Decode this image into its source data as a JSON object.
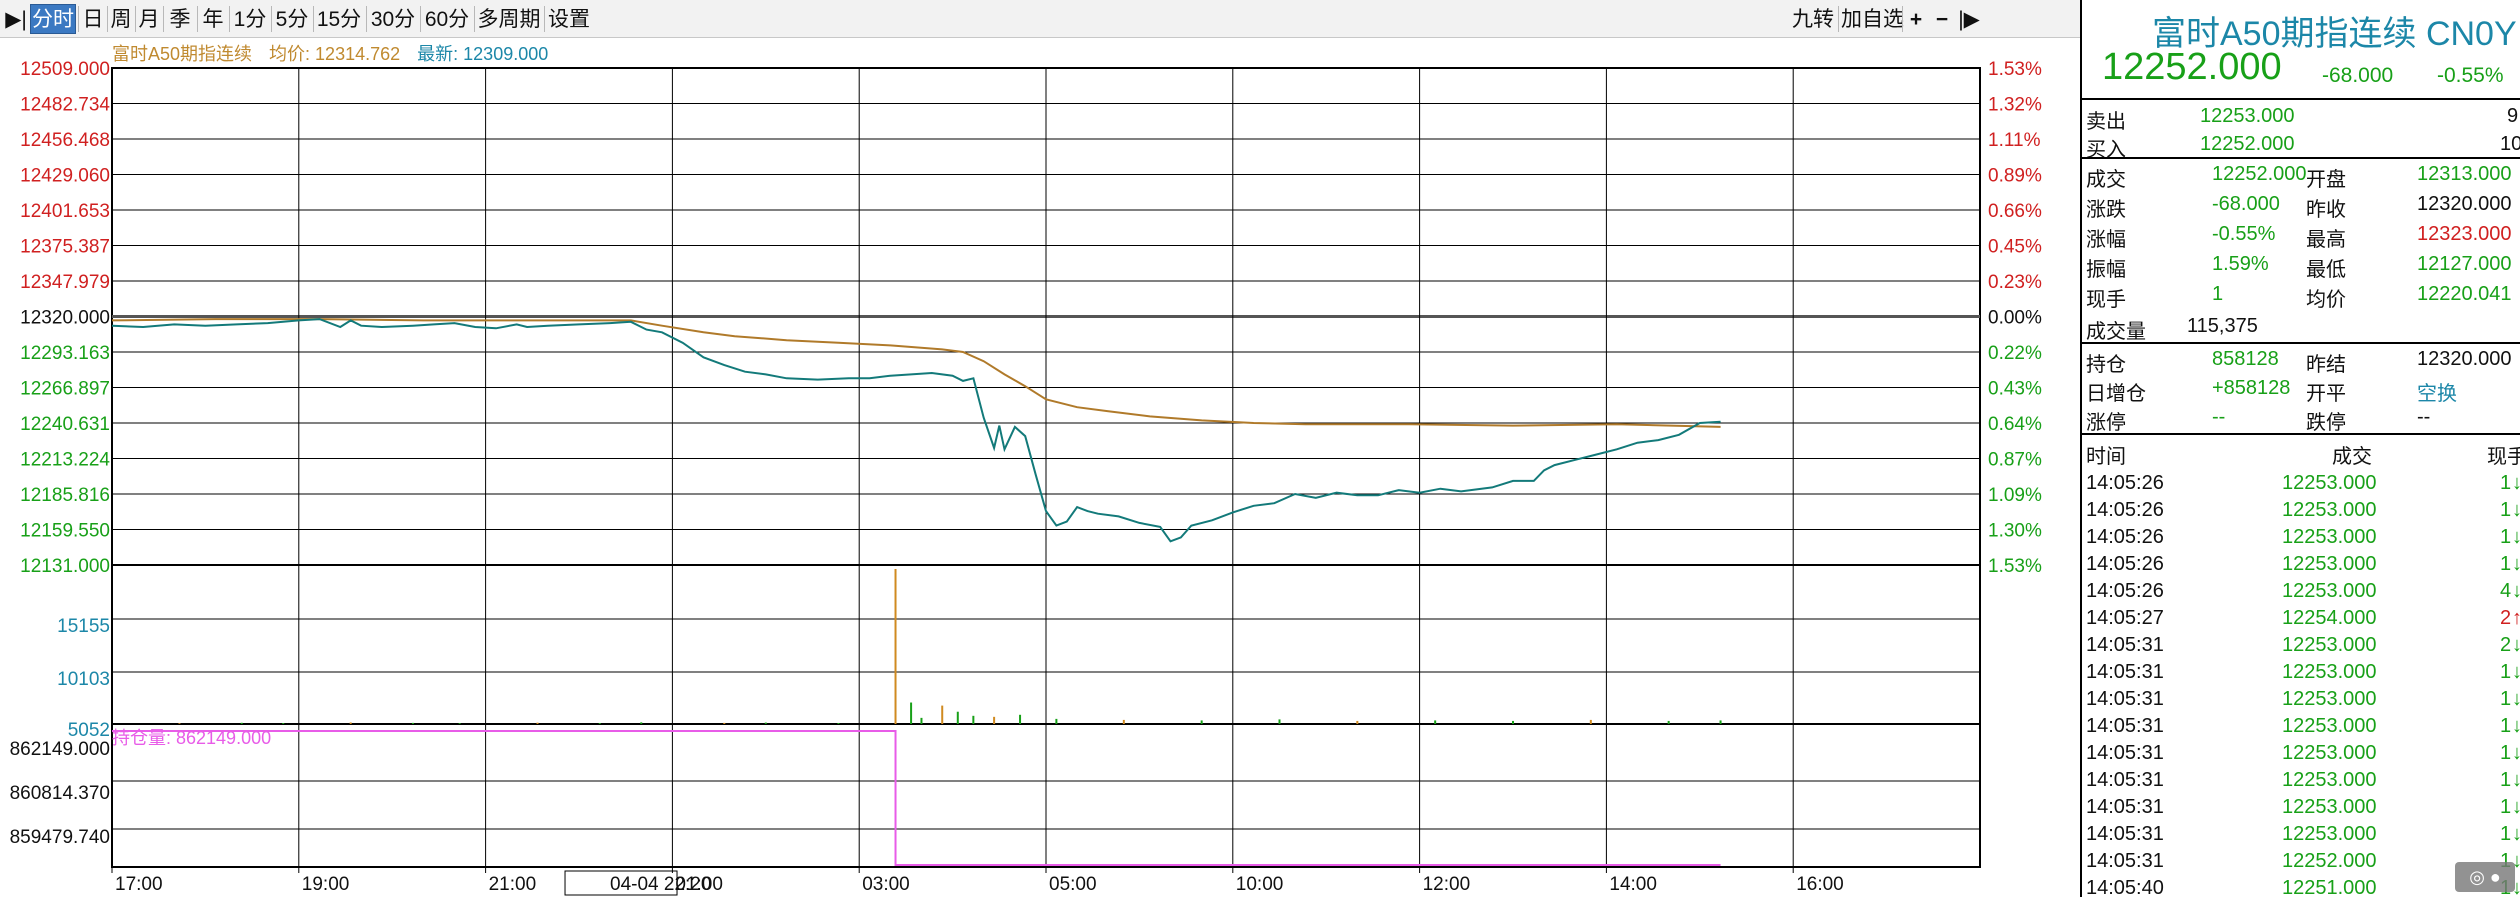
{
  "toolbar": {
    "left": [
      "▶|",
      "分时",
      "日",
      "周",
      "月",
      "季",
      "年",
      "1分",
      "5分",
      "15分",
      "30分",
      "60分",
      "多周期",
      "设置"
    ],
    "right": [
      "九转",
      "加自选",
      "+",
      "−",
      "|▶"
    ]
  },
  "info": {
    "name": "富时A50期指连续",
    "avg": "均价: 12314.762",
    "latest": "最新: 12309.000"
  },
  "price_axis": [
    "12509.000",
    "12482.734",
    "12456.468",
    "12429.060",
    "12401.653",
    "12375.387",
    "12347.979",
    "12320.000",
    "12293.163",
    "12266.897",
    "12240.631",
    "12213.224",
    "12185.816",
    "12159.550",
    "12131.000"
  ],
  "pct_axis": [
    "1.53%",
    "1.32%",
    "1.11%",
    "0.89%",
    "0.66%",
    "0.45%",
    "0.23%",
    "0.00%",
    "0.22%",
    "0.43%",
    "0.64%",
    "0.87%",
    "1.09%",
    "1.30%",
    "1.53%"
  ],
  "vol_axis": [
    "15155",
    "10103",
    "5052"
  ],
  "oi": {
    "label": "持仓量: 862149.000",
    "axis": [
      "862149.000",
      "860814.370",
      "859479.740"
    ]
  },
  "time_axis": [
    "17:00",
    "19:00",
    "21:00",
    "04-04 22:20",
    "01:00",
    "03:00",
    "05:00",
    "10:00",
    "12:00",
    "14:00",
    "16:00"
  ],
  "panel": {
    "title": "富时A50期指连续 CN0Y",
    "price": "12252.000",
    "change": "-68.000",
    "change_pct": "-0.55%",
    "ask_label": "卖出",
    "ask_price": "12253.000",
    "ask_vol": "9",
    "bid_label": "买入",
    "bid_price": "12252.000",
    "bid_vol": "10",
    "stats": [
      {
        "l1": "成交",
        "v1": "12252.000",
        "l2": "开盘",
        "v2": "12313.000"
      },
      {
        "l1": "涨跌",
        "v1": "-68.000",
        "l2": "昨收",
        "v2": "12320.000"
      },
      {
        "l1": "涨幅",
        "v1": "-0.55%",
        "l2": "最高",
        "v2": "12323.000"
      },
      {
        "l1": "振幅",
        "v1": "1.59%",
        "l2": "最低",
        "v2": "12127.000"
      },
      {
        "l1": "现手",
        "v1": "1",
        "l2": "均价",
        "v2": "12220.041"
      }
    ],
    "volume_label": "成交量",
    "volume": "115,375",
    "stats2": [
      {
        "l1": "持仓",
        "v1": "858128",
        "l2": "昨结",
        "v2": "12320.000"
      },
      {
        "l1": "日增仓",
        "v1": "+858128",
        "l2": "开平",
        "v2": "空换"
      },
      {
        "l1": "涨停",
        "v1": "--",
        "l2": "跌停",
        "v2": "--"
      }
    ],
    "tick_headers": [
      "时间",
      "成交",
      "现手"
    ],
    "ticks": [
      {
        "t": "14:05:26",
        "p": "12253.000",
        "v": "1",
        "d": "down"
      },
      {
        "t": "14:05:26",
        "p": "12253.000",
        "v": "1",
        "d": "down"
      },
      {
        "t": "14:05:26",
        "p": "12253.000",
        "v": "1",
        "d": "down"
      },
      {
        "t": "14:05:26",
        "p": "12253.000",
        "v": "1",
        "d": "down"
      },
      {
        "t": "14:05:26",
        "p": "12253.000",
        "v": "4",
        "d": "down"
      },
      {
        "t": "14:05:27",
        "p": "12254.000",
        "v": "2",
        "d": "up"
      },
      {
        "t": "14:05:31",
        "p": "12253.000",
        "v": "2",
        "d": "down"
      },
      {
        "t": "14:05:31",
        "p": "12253.000",
        "v": "1",
        "d": "down"
      },
      {
        "t": "14:05:31",
        "p": "12253.000",
        "v": "1",
        "d": "down"
      },
      {
        "t": "14:05:31",
        "p": "12253.000",
        "v": "1",
        "d": "down"
      },
      {
        "t": "14:05:31",
        "p": "12253.000",
        "v": "1",
        "d": "down"
      },
      {
        "t": "14:05:31",
        "p": "12253.000",
        "v": "1",
        "d": "down"
      },
      {
        "t": "14:05:31",
        "p": "12253.000",
        "v": "1",
        "d": "down"
      },
      {
        "t": "14:05:31",
        "p": "12253.000",
        "v": "1",
        "d": "down"
      },
      {
        "t": "14:05:31",
        "p": "12252.000",
        "v": "1",
        "d": "down"
      },
      {
        "t": "14:05:40",
        "p": "12251.000",
        "v": "1",
        "d": "down"
      }
    ]
  },
  "chart_data": {
    "type": "line",
    "title": "富时A50期指连续",
    "x": [
      "17:00",
      "19:00",
      "21:00",
      "23:00",
      "01:00",
      "03:00",
      "05:00",
      "10:00",
      "12:00",
      "14:00",
      "16:00"
    ],
    "ylim": [
      12131,
      12509
    ],
    "reference": 12320,
    "series": [
      {
        "values": [
          [
            0,
            12313
          ],
          [
            6,
            12312
          ],
          [
            12,
            12314
          ],
          [
            18,
            12313
          ],
          [
            24,
            12314
          ],
          [
            30,
            12315
          ],
          [
            36,
            12317
          ],
          [
            40,
            12318
          ],
          [
            44,
            12312
          ],
          [
            46,
            12317
          ],
          [
            48,
            12313
          ],
          [
            52,
            12312
          ],
          [
            58,
            12313
          ],
          [
            62,
            12314
          ],
          [
            66,
            12315
          ],
          [
            70,
            12312
          ],
          [
            74,
            12311
          ],
          [
            78,
            12314
          ],
          [
            80,
            12312
          ],
          [
            84,
            12313
          ],
          [
            90,
            12314
          ],
          [
            96,
            12315
          ],
          [
            100,
            12316
          ],
          [
            103,
            12310
          ],
          [
            106,
            12308
          ],
          [
            110,
            12300
          ],
          [
            114,
            12289
          ],
          [
            118,
            12283
          ],
          [
            122,
            12278
          ],
          [
            126,
            12276
          ],
          [
            130,
            12273
          ],
          [
            136,
            12272
          ],
          [
            142,
            12273
          ],
          [
            146,
            12273
          ],
          [
            150,
            12275
          ],
          [
            154,
            12276
          ],
          [
            158,
            12277
          ],
          [
            162,
            12275
          ],
          [
            164,
            12271
          ],
          [
            166,
            12273
          ],
          [
            168,
            12243
          ],
          [
            170,
            12220
          ],
          [
            171,
            12237
          ],
          [
            172,
            12219
          ],
          [
            174,
            12236
          ],
          [
            176,
            12229
          ],
          [
            178,
            12200
          ],
          [
            180,
            12172
          ],
          [
            182,
            12161
          ],
          [
            184,
            12164
          ],
          [
            186,
            12175
          ],
          [
            188,
            12172
          ],
          [
            190,
            12170
          ],
          [
            194,
            12168
          ],
          [
            198,
            12163
          ],
          [
            202,
            12160
          ],
          [
            204,
            12149
          ],
          [
            206,
            12152
          ],
          [
            208,
            12161
          ],
          [
            212,
            12165
          ],
          [
            216,
            12171
          ],
          [
            220,
            12176
          ],
          [
            224,
            12178
          ],
          [
            228,
            12185
          ],
          [
            232,
            12182
          ],
          [
            236,
            12186
          ],
          [
            240,
            12184
          ],
          [
            244,
            12184
          ],
          [
            248,
            12188
          ],
          [
            252,
            12186
          ],
          [
            256,
            12189
          ],
          [
            260,
            12187
          ],
          [
            266,
            12190
          ],
          [
            270,
            12195
          ],
          [
            274,
            12195
          ],
          [
            276,
            12203
          ],
          [
            278,
            12207
          ],
          [
            282,
            12211
          ],
          [
            286,
            12215
          ],
          [
            290,
            12219
          ],
          [
            294,
            12224
          ],
          [
            298,
            12226
          ],
          [
            302,
            12230
          ],
          [
            306,
            12239
          ],
          [
            310,
            12240
          ]
        ]
      },
      {
        "values": [
          [
            0,
            12317
          ],
          [
            20,
            12318
          ],
          [
            40,
            12318
          ],
          [
            60,
            12317
          ],
          [
            80,
            12317
          ],
          [
            100,
            12317
          ],
          [
            106,
            12313
          ],
          [
            114,
            12308
          ],
          [
            120,
            12305
          ],
          [
            130,
            12302
          ],
          [
            140,
            12300
          ],
          [
            150,
            12298
          ],
          [
            160,
            12295
          ],
          [
            164,
            12293
          ],
          [
            168,
            12286
          ],
          [
            172,
            12276
          ],
          [
            176,
            12267
          ],
          [
            180,
            12257
          ],
          [
            186,
            12251
          ],
          [
            192,
            12248
          ],
          [
            200,
            12244
          ],
          [
            210,
            12241
          ],
          [
            220,
            12239
          ],
          [
            230,
            12238
          ],
          [
            250,
            12238
          ],
          [
            270,
            12237
          ],
          [
            290,
            12238
          ],
          [
            310,
            12236
          ]
        ]
      }
    ],
    "volume": [
      [
        13,
        80
      ],
      [
        25,
        120
      ],
      [
        33,
        95
      ],
      [
        46,
        150
      ],
      [
        58,
        110
      ],
      [
        67,
        90
      ],
      [
        82,
        130
      ],
      [
        94,
        100
      ],
      [
        102,
        160
      ],
      [
        118,
        110
      ],
      [
        126,
        140
      ],
      [
        140,
        100
      ],
      [
        151,
        15155
      ],
      [
        154,
        2100
      ],
      [
        156,
        600
      ],
      [
        160,
        1800
      ],
      [
        163,
        1200
      ],
      [
        166,
        800
      ],
      [
        170,
        700
      ],
      [
        175,
        900
      ],
      [
        182,
        500
      ],
      [
        195,
        400
      ],
      [
        210,
        350
      ],
      [
        225,
        450
      ],
      [
        240,
        300
      ],
      [
        255,
        350
      ],
      [
        270,
        300
      ],
      [
        285,
        400
      ],
      [
        300,
        300
      ],
      [
        310,
        350
      ]
    ],
    "open_interest": {
      "before": 862149,
      "after": 858128,
      "step_at": 151
    }
  }
}
